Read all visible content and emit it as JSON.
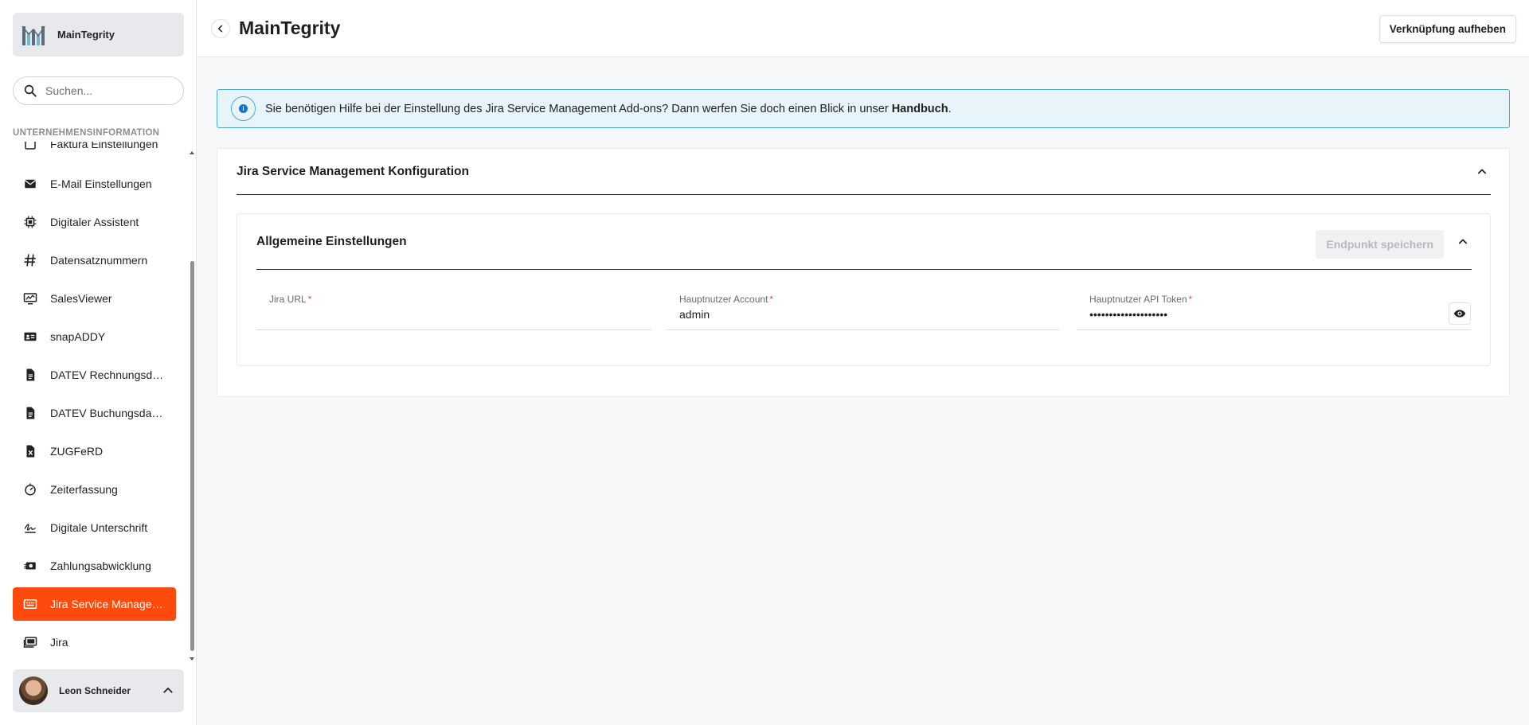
{
  "brand": {
    "name": "MainTegrity",
    "logo_icon": "maintegrity-logo-icon"
  },
  "search": {
    "placeholder": "Suchen..."
  },
  "sidebar": {
    "section_label": "UNTERNEHMENSINFORMATION",
    "items": [
      {
        "label": "Faktura Einstellungen",
        "icon": "invoice-settings-icon"
      },
      {
        "label": "E-Mail Einstellungen",
        "icon": "mail-icon"
      },
      {
        "label": "Digitaler Assistent",
        "icon": "chip-icon"
      },
      {
        "label": "Datensatznummern",
        "icon": "hash-icon"
      },
      {
        "label": "SalesViewer",
        "icon": "monitor-chart-icon"
      },
      {
        "label": "snapADDY",
        "icon": "contact-card-icon"
      },
      {
        "label": "DATEV Rechnungsdaten",
        "icon": "document-icon"
      },
      {
        "label": "DATEV Buchungsdaten",
        "icon": "document-icon"
      },
      {
        "label": "ZUGFeRD",
        "icon": "excel-file-icon"
      },
      {
        "label": "Zeiterfassung",
        "icon": "timer-icon"
      },
      {
        "label": "Digitale Unterschrift",
        "icon": "signature-icon"
      },
      {
        "label": "Zahlungsabwicklung",
        "icon": "payment-icon"
      },
      {
        "label": "Jira Service Management",
        "icon": "service-desk-icon",
        "active": true
      },
      {
        "label": "Jira",
        "icon": "jira-icon"
      }
    ]
  },
  "user": {
    "name": "Leon Schneider"
  },
  "header": {
    "title": "MainTegrity",
    "unlink_label": "Verknüpfung aufheben"
  },
  "info": {
    "text": "Sie benötigen Hilfe bei der Einstellung des Jira Service Management Add-ons? Dann werfen Sie doch einen Blick in unser ",
    "link": "Handbuch",
    "suffix": "."
  },
  "config": {
    "title": "Jira Service Management Konfiguration",
    "general": {
      "title": "Allgemeine Einstellungen",
      "save_label": "Endpunkt speichern",
      "fields": {
        "jira_url": {
          "label": "Jira URL",
          "value": ""
        },
        "main_account": {
          "label": "Hauptnutzer Account",
          "value": "admin"
        },
        "api_token": {
          "label": "Hauptnutzer API Token",
          "value": "••••••••••••••••••••"
        }
      },
      "required_mark": "*"
    }
  },
  "colors": {
    "accent": "#ff4a0d",
    "info_border": "#4ea7d2",
    "info_bg": "#e7f5fb"
  }
}
